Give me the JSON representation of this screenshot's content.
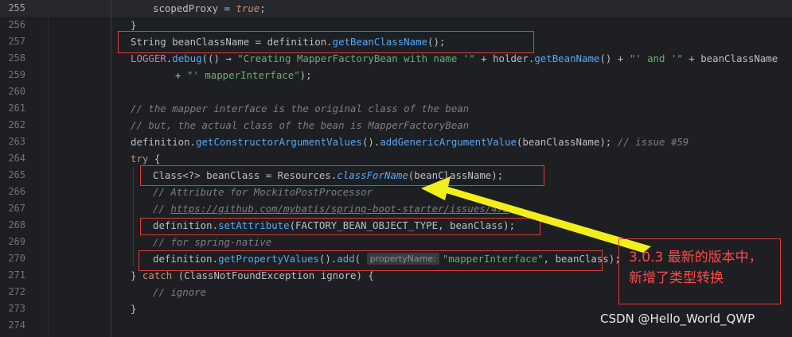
{
  "editor": {
    "lines": [
      {
        "num": "255",
        "current": true,
        "indent": 192,
        "segs": [
          [
            "scopedProxy = ",
            ""
          ],
          [
            "true",
            "kwi"
          ],
          [
            ";",
            ""
          ]
        ]
      },
      {
        "num": "256",
        "indent": 164,
        "segs": [
          [
            "}",
            ""
          ]
        ]
      },
      {
        "num": "257",
        "indent": 164,
        "segs": [
          [
            "String beanClassName = definition.",
            ""
          ],
          [
            "getBeanClassName",
            "fn"
          ],
          [
            "();",
            ""
          ]
        ]
      },
      {
        "num": "258",
        "indent": 164,
        "segs": [
          [
            "LOGGER",
            "fld"
          ],
          [
            ".",
            ""
          ],
          [
            "debug",
            "fn"
          ],
          [
            "(() → ",
            ""
          ],
          [
            "\"Creating MapperFactoryBean with name '\"",
            "str"
          ],
          [
            " + holder.",
            ""
          ],
          [
            "getBeanName",
            "fn"
          ],
          [
            "() + ",
            ""
          ],
          [
            "\"' and '\"",
            "str"
          ],
          [
            " + beanClassName",
            ""
          ]
        ]
      },
      {
        "num": "259",
        "indent": 220,
        "segs": [
          [
            "+ ",
            ""
          ],
          [
            "\"' mapperInterface\"",
            "str"
          ],
          [
            ");",
            ""
          ]
        ]
      },
      {
        "num": "260",
        "indent": 164,
        "segs": []
      },
      {
        "num": "261",
        "indent": 164,
        "segs": [
          [
            "// the mapper interface is the original class of the bean",
            "cmt"
          ]
        ]
      },
      {
        "num": "262",
        "indent": 164,
        "segs": [
          [
            "// but, the actual class of the bean is MapperFactoryBean",
            "cmt"
          ]
        ]
      },
      {
        "num": "263",
        "indent": 164,
        "segs": [
          [
            "definition.",
            ""
          ],
          [
            "getConstructorArgumentValues",
            "fn"
          ],
          [
            "().",
            ""
          ],
          [
            "addGenericArgumentValue",
            "fn"
          ],
          [
            "(beanClassName); ",
            ""
          ],
          [
            "// issue #59",
            "cmt"
          ]
        ]
      },
      {
        "num": "264",
        "indent": 164,
        "segs": [
          [
            "try",
            "kw"
          ],
          [
            " {",
            ""
          ]
        ]
      },
      {
        "num": "265",
        "indent": 192,
        "segs": [
          [
            "Class<?> beanClass = Resources.",
            ""
          ],
          [
            "classForName",
            "fni"
          ],
          [
            "(beanClassName);",
            ""
          ]
        ]
      },
      {
        "num": "266",
        "indent": 192,
        "segs": [
          [
            "// Attribute for MockitoPostProcessor",
            "cmt"
          ]
        ]
      },
      {
        "num": "267",
        "indent": 192,
        "segs": [
          [
            "// ",
            "cmt"
          ],
          [
            "https://github.com/mybatis/spring-boot-starter/issues/475",
            "cmtlink"
          ]
        ]
      },
      {
        "num": "268",
        "indent": 192,
        "segs": [
          [
            "definition.",
            ""
          ],
          [
            "setAttribute",
            "fn"
          ],
          [
            "(FACTORY_BEAN_OBJECT_TYPE, beanClass);",
            ""
          ]
        ]
      },
      {
        "num": "269",
        "indent": 192,
        "segs": [
          [
            "// for spring-native",
            "cmt"
          ]
        ]
      },
      {
        "num": "270",
        "indent": 192,
        "segs": [
          [
            "definition.",
            ""
          ],
          [
            "getPropertyValues",
            "fn"
          ],
          [
            "().",
            ""
          ],
          [
            "add",
            "fn"
          ],
          [
            "( ",
            ""
          ],
          [
            "propertyName:",
            "hint"
          ],
          [
            "\"mapperInterface\"",
            "str"
          ],
          [
            ", beanClass);",
            ""
          ]
        ]
      },
      {
        "num": "271",
        "indent": 164,
        "segs": [
          [
            "} ",
            ""
          ],
          [
            "catch",
            "kw"
          ],
          [
            " (ClassNotFoundException ignore) {",
            ""
          ]
        ]
      },
      {
        "num": "272",
        "indent": 192,
        "segs": [
          [
            "// ignore",
            "cmt"
          ]
        ]
      },
      {
        "num": "273",
        "indent": 164,
        "segs": [
          [
            "}",
            ""
          ]
        ]
      },
      {
        "num": "274",
        "indent": 164,
        "segs": []
      }
    ]
  },
  "annotation": {
    "line1": "3.0.3 最新的版本中，",
    "line2": "新增了类型转换",
    "color": "#ff4a4a"
  },
  "watermark": "CSDN @Hello_World_QWP",
  "colors": {
    "background": "#1e1f22",
    "highlight_box": "#e03a3a",
    "arrow": "#f2ee1c"
  }
}
